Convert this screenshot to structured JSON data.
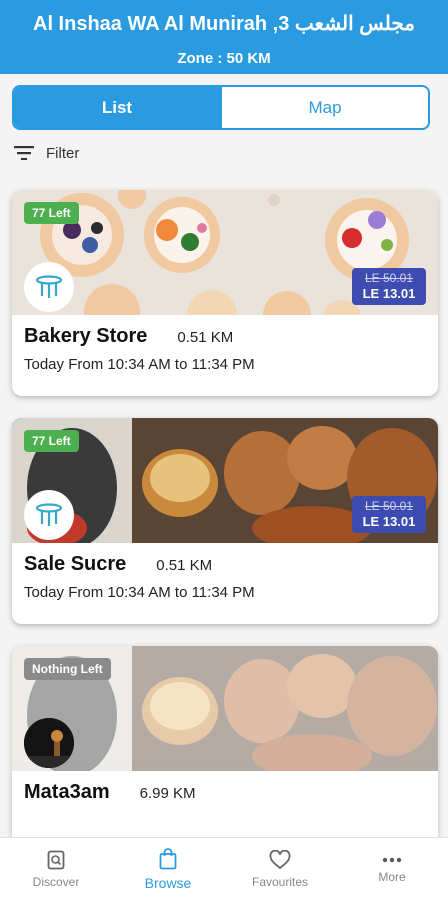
{
  "header": {
    "title": "Al Inshaa WA Al Munirah ,مجلس الشعب 3",
    "zone": "Zone : 50 KM"
  },
  "tabs": {
    "list_label": "List",
    "map_label": "Map"
  },
  "filter_label": "Filter",
  "stores": [
    {
      "badge": "77 Left",
      "name": "Bakery Store",
      "distance": "0.51 KM",
      "hours": "Today From 10:34 AM to 11:34 PM",
      "old_price": "LE 50.01",
      "new_price": "LE 13.01"
    },
    {
      "badge": "77 Left",
      "name": "Sale Sucre",
      "distance": "0.51 KM",
      "hours": "Today From 10:34 AM to 11:34 PM",
      "old_price": "LE 50.01",
      "new_price": "LE 13.01"
    },
    {
      "badge": "Nothing Left",
      "name": "Mata3am",
      "distance": "6.99 KM"
    }
  ],
  "nav": {
    "discover": "Discover",
    "browse": "Browse",
    "favourites": "Favourites",
    "more": "More"
  },
  "colors": {
    "primary": "#2a9be0",
    "badge_green": "#4caf50",
    "price_bg": "#3e4bb0"
  }
}
